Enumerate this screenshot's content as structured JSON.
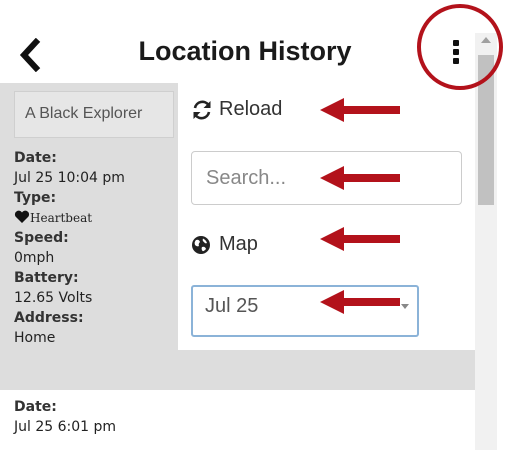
{
  "header": {
    "title": "Location History"
  },
  "sidebar": {
    "device_name": "A Black Explorer",
    "entries": [
      {
        "date_label": "Date:",
        "date": "Jul 25 10:04 pm",
        "type_label": "Type:",
        "type": "Heartbeat",
        "speed_label": "Speed:",
        "speed": "0mph",
        "battery_label": "Battery:",
        "battery": "12.65 Volts",
        "address_label": "Address:",
        "address": "Home"
      },
      {
        "date_label": "Date:",
        "date": "Jul 25 6:01 pm"
      }
    ]
  },
  "panel": {
    "reload_label": "Reload",
    "search_placeholder": "Search...",
    "map_label": "Map",
    "date_selected": "Jul 25"
  },
  "colors": {
    "annotation_red": "#b3121b",
    "list_bg": "#dddddd",
    "select_border": "#8bb3d8"
  },
  "icons": {
    "back": "chevron-left-icon",
    "menu": "vertical-ellipsis-icon",
    "reload": "refresh-icon",
    "map": "globe-icon",
    "type": "heart-icon"
  }
}
